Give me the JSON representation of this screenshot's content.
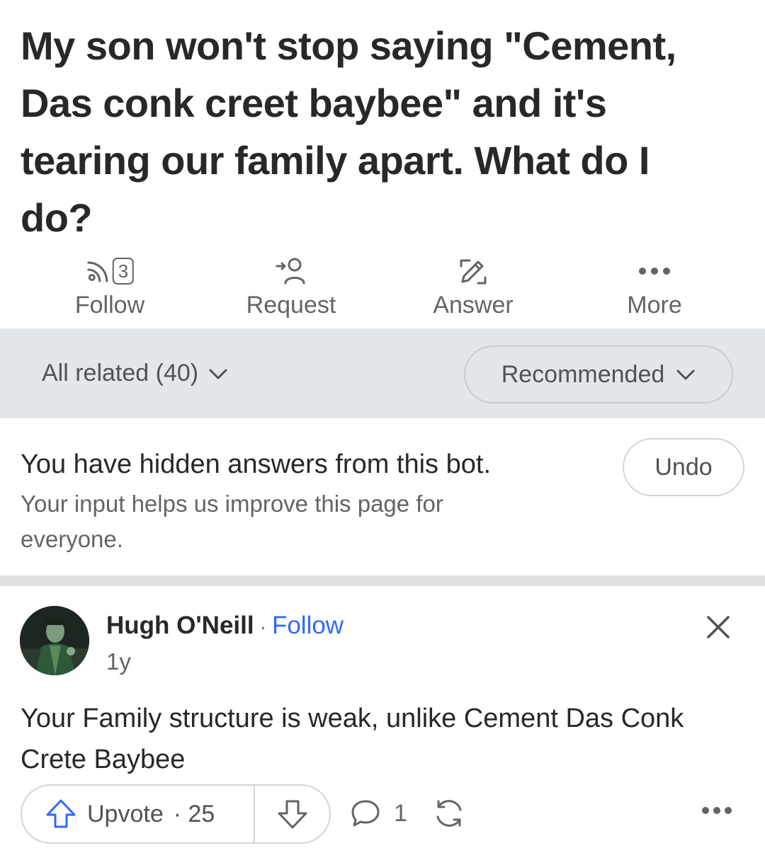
{
  "question": {
    "title": "My son won't stop saying \"Cement, Das conk creet baybee\" and it's tearing our family apart. What do I do?"
  },
  "actions": [
    {
      "label": "Follow",
      "icon": "follow-feed-icon",
      "badge": "3"
    },
    {
      "label": "Request",
      "icon": "request-user-icon"
    },
    {
      "label": "Answer",
      "icon": "pencil-icon"
    },
    {
      "label": "More",
      "icon": "more-dots-icon"
    }
  ],
  "filters": {
    "all_related": "All related (40)",
    "sort": "Recommended"
  },
  "hidden_notice": {
    "title": "You have hidden answers from this bot.",
    "subtitle": "Your input helps us improve this page for everyone.",
    "undo_label": "Undo"
  },
  "answer": {
    "author": "Hugh O'Neill",
    "separator": "·",
    "follow_label": "Follow",
    "age": "1y",
    "text": "Your Family structure is weak, unlike Cement Das Conk Crete Baybee",
    "upvote_label": "Upvote",
    "upvote_count_text": "· 25",
    "comment_count": "1"
  },
  "colors": {
    "link_blue": "#2e69ff",
    "text_primary": "#282829",
    "text_secondary": "#636466",
    "filter_bg": "#e4e7e9"
  }
}
